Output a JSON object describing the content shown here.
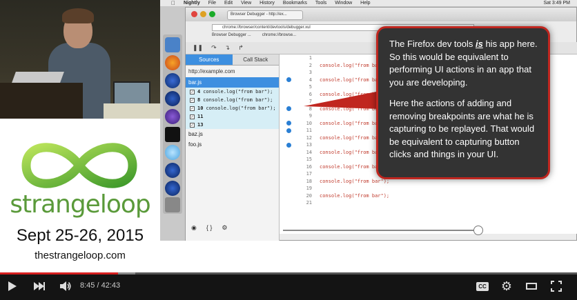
{
  "conference": {
    "brand_name": "strangeloop",
    "dates": "Sept 25-26, 2015",
    "url": "thestrangeloop.com"
  },
  "os_menubar": {
    "app": "Nightly",
    "items": [
      "File",
      "Edit",
      "View",
      "History",
      "Bookmarks",
      "Tools",
      "Window",
      "Help"
    ],
    "clock": "Sat 3:49 PM"
  },
  "browser": {
    "tab_title": "Browser Debugger - http://ex...",
    "url": "chrome://browser/content/devtools/debugger.xul",
    "bookmarks": [
      "Browser Debugger ...",
      "chrome://browse..."
    ]
  },
  "debugger": {
    "tabs": [
      "Sources",
      "Call Stack"
    ],
    "host": "http://example.com",
    "files": [
      "bar.js",
      "baz.js",
      "foo.js"
    ],
    "breakpoints": [
      {
        "line": "4",
        "text": "console.log(\"from bar\");"
      },
      {
        "line": "8",
        "text": "console.log(\"from bar\");"
      },
      {
        "line": "10",
        "text": "console.log(\"from bar\");"
      },
      {
        "line": "11",
        "text": ""
      },
      {
        "line": "13",
        "text": ""
      }
    ],
    "code_lines": [
      {
        "n": "1",
        "code": "",
        "bp": false
      },
      {
        "n": "2",
        "code": "console.log(\"from bar\");",
        "bp": false
      },
      {
        "n": "3",
        "code": "",
        "bp": false
      },
      {
        "n": "4",
        "code": "console.log(\"from bar\");",
        "bp": true
      },
      {
        "n": "5",
        "code": "",
        "bp": false
      },
      {
        "n": "6",
        "code": "console.log(\"from bar\");",
        "bp": false
      },
      {
        "n": "7",
        "code": "",
        "bp": false
      },
      {
        "n": "8",
        "code": "console.log(\"from bar\");",
        "bp": true
      },
      {
        "n": "9",
        "code": "",
        "bp": false
      },
      {
        "n": "10",
        "code": "console.log(\"from bar\");",
        "bp": true
      },
      {
        "n": "11",
        "code": "",
        "bp": true
      },
      {
        "n": "12",
        "code": "console.log(\"from bar\");",
        "bp": false
      },
      {
        "n": "13",
        "code": "",
        "bp": true
      },
      {
        "n": "14",
        "code": "console.log(\"from bar\");",
        "bp": false
      },
      {
        "n": "15",
        "code": "",
        "bp": false
      },
      {
        "n": "16",
        "code": "console.log(\"from bar\");",
        "bp": false
      },
      {
        "n": "17",
        "code": "",
        "bp": false
      },
      {
        "n": "18",
        "code": "console.log(\"from bar\");",
        "bp": false
      },
      {
        "n": "19",
        "code": "",
        "bp": false
      },
      {
        "n": "20",
        "code": "console.log(\"from bar\");",
        "bp": false
      },
      {
        "n": "21",
        "code": "",
        "bp": false
      }
    ],
    "footer_icons": [
      "eye-icon",
      "braces-icon",
      "gear-icon"
    ]
  },
  "callout": {
    "paragraph1_a": "The Firefox dev tools ",
    "paragraph1_em": "is",
    "paragraph1_b": " his app here.  So this would be equivalent to performing UI actions in an app that you are developing.",
    "paragraph2": "Here the actions of adding and removing breakpoints are what he is capturing to be replayed.  That would be equivalent to capturing button clicks and things in your UI."
  },
  "player": {
    "current_time": "8:45",
    "duration": "42:43",
    "time_display": "8:45 / 42:43",
    "progress_played": 0.205,
    "progress_loaded": 0.235,
    "cc_label": "CC",
    "colors": {
      "played": "#d61f1f",
      "callout_border": "#c0261f"
    }
  }
}
